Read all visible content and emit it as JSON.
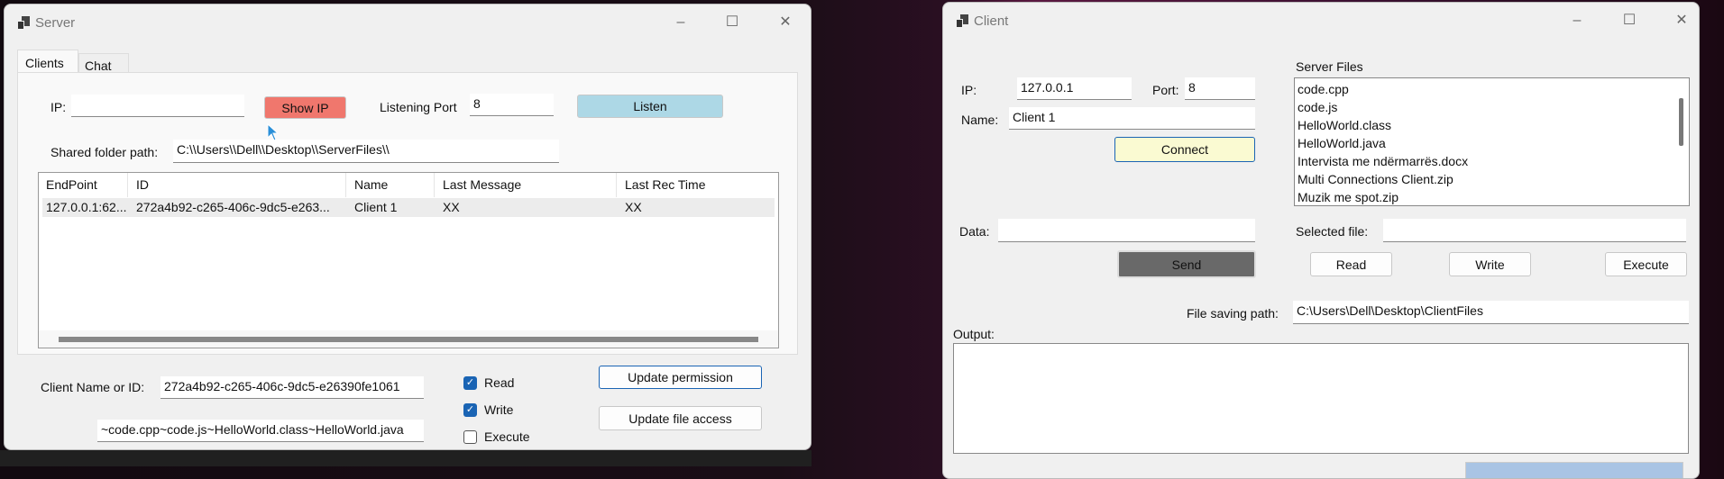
{
  "server": {
    "title": "Server",
    "tabs": [
      {
        "label": "Clients",
        "active": true
      },
      {
        "label": "Chat",
        "active": false
      }
    ],
    "ip_label": "IP:",
    "ip_value": "",
    "show_ip_label": "Show IP",
    "show_ip_color": "#f0776d",
    "port_label": "Listening Port",
    "port_value": "8",
    "listen_label": "Listen",
    "listen_color": "#add8e6",
    "shared_label": "Shared folder path:",
    "shared_value": "C:\\\\Users\\\\Dell\\\\Desktop\\\\ServerFiles\\\\",
    "columns": [
      "EndPoint",
      "ID",
      "Name",
      "Last Message",
      "Last Rec Time"
    ],
    "rows": [
      [
        "127.0.0.1:62...",
        "272a4b92-c265-406c-9dc5-e263...",
        "Client 1",
        "XX",
        "XX"
      ]
    ],
    "client_label": "Client Name or ID:",
    "client_value": "272a4b92-c265-406c-9dc5-e26390fe1061",
    "files_value": "~code.cpp~code.js~HelloWorld.class~HelloWorld.java",
    "perms": [
      {
        "label": "Read",
        "checked": true
      },
      {
        "label": "Write",
        "checked": true
      },
      {
        "label": "Execute",
        "checked": false
      }
    ],
    "update_permission": "Update permission",
    "update_file_access": "Update file access"
  },
  "client": {
    "title": "Client",
    "ip_label": "IP:",
    "ip_value": "127.0.0.1",
    "port_label": "Port:",
    "port_value": "8",
    "name_label": "Name:",
    "name_value": "Client 1",
    "connect_label": "Connect",
    "connect_color": "#fafad2",
    "server_files_label": "Server Files",
    "files": [
      "code.cpp",
      "code.js",
      "HelloWorld.class",
      "HelloWorld.java",
      "Intervista me ndërmarrës.docx",
      "Multi Connections Client.zip",
      "Muzik me spot.zip"
    ],
    "data_label": "Data:",
    "data_value": "",
    "send_label": "Send",
    "send_color": "#696969",
    "selected_label": "Selected file:",
    "selected_value": "",
    "read_label": "Read",
    "write_label": "Write",
    "execute_label": "Execute",
    "saving_label": "File saving path:",
    "saving_value": "C:\\Users\\Dell\\Desktop\\ClientFiles",
    "output_label": "Output:",
    "output_value": ""
  }
}
